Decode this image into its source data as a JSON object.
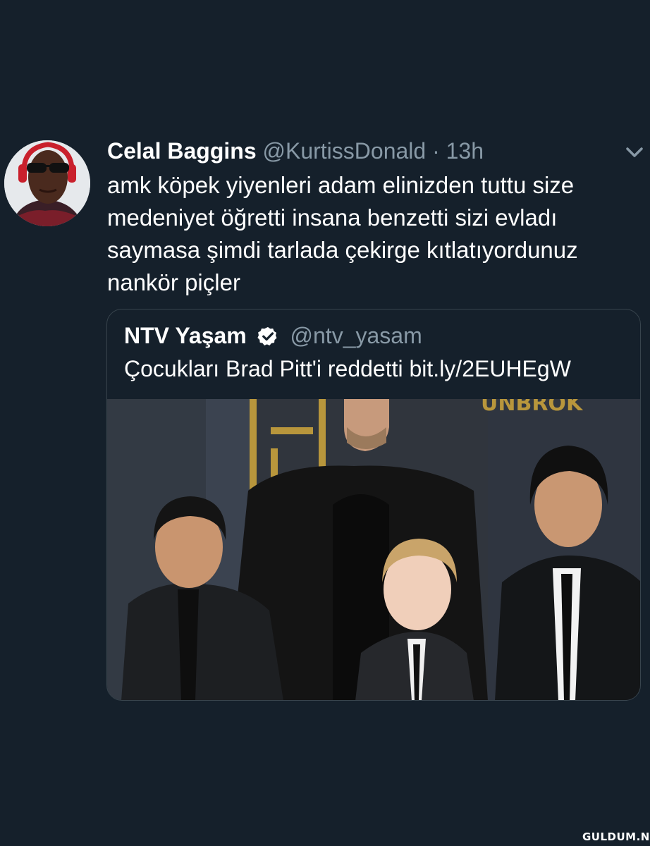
{
  "tweet": {
    "display_name": "Celal Baggins",
    "handle": "@KurtissDonald",
    "separator": "·",
    "time": "13h",
    "text": "amk köpek yiyenleri adam elinizden tuttu size medeniyet öğretti insana benzetti sizi evladı saymasa şimdi tarlada çekirge kıtlatıyordunuz nankör piçler",
    "avatar": "profile-photo",
    "menu_icon": "chevron-down-icon"
  },
  "quoted_tweet": {
    "display_name": "NTV Yaşam",
    "verified_icon": "verified-badge-icon",
    "handle": "@ntv_yasam",
    "text": "Çocukları Brad Pitt'i reddetti bit.ly/2EUHEgW",
    "image": "red-carpet-photo"
  },
  "watermark": {
    "text": "GULDUM.NET"
  },
  "colors": {
    "background": "#15202b",
    "primary_text": "#ffffff",
    "secondary_text": "#8899a6",
    "border": "#38444d"
  }
}
